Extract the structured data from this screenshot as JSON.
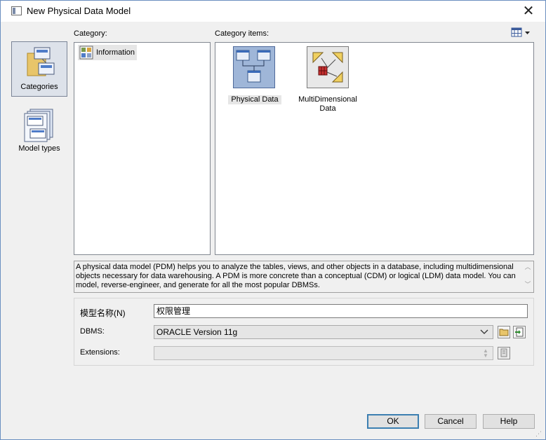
{
  "window": {
    "title": "New Physical Data Model"
  },
  "nav": [
    {
      "label": "Categories",
      "icon": "folder-categories-icon"
    },
    {
      "label": "Model types",
      "icon": "model-types-icon"
    }
  ],
  "category": {
    "label": "Category:",
    "items": [
      {
        "label": "Information",
        "icon": "information-category-icon"
      }
    ]
  },
  "category_items": {
    "label": "Category items:",
    "items": [
      {
        "label": "Physical Data",
        "icon": "physical-data-model-icon",
        "selected": true
      },
      {
        "label_line1": "MultiDimensional",
        "label_line2": "Data",
        "icon": "multidimensional-data-icon"
      }
    ]
  },
  "description": "A physical data model (PDM) helps you to analyze the tables, views, and other objects in a database, including multidimensional objects necessary for data warehousing. A PDM is more concrete than a conceptual (CDM) or logical (LDM) data model. You can model, reverse-engineer, and generate for all the most popular DBMSs.",
  "form": {
    "model_name_label": "模型名称(N)",
    "model_name_value": "权限管理",
    "dbms_label": "DBMS:",
    "dbms_value": "ORACLE Version 11g",
    "extensions_label": "Extensions:",
    "extensions_value": ""
  },
  "buttons": {
    "ok": "OK",
    "cancel": "Cancel",
    "help": "Help"
  },
  "colors": {
    "accent": "#3c7fb1",
    "selection": "#dde2ea",
    "window_border": "#6a8fc0"
  }
}
